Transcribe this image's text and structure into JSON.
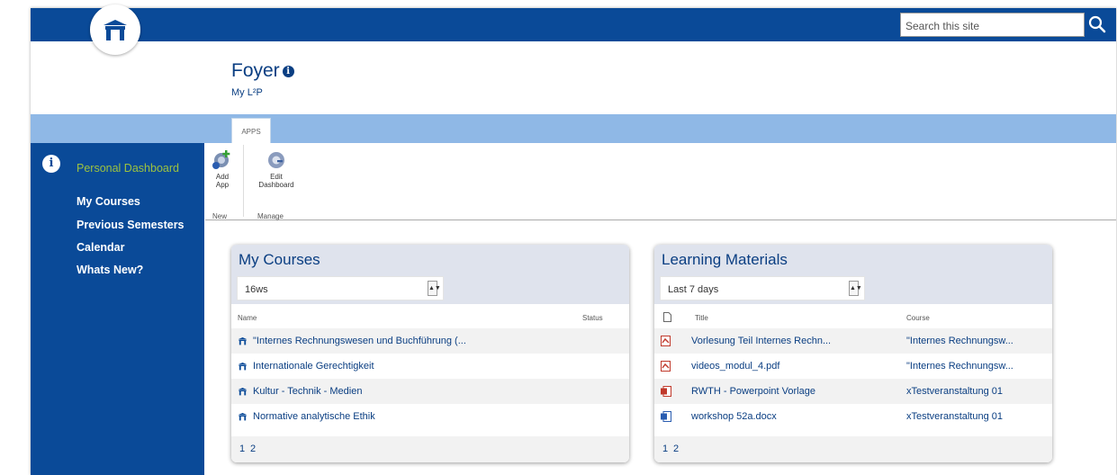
{
  "search": {
    "placeholder": "Search this site"
  },
  "site": {
    "title": "Foyer",
    "subtitle": "My L²P"
  },
  "ribbon": {
    "tab": "APPS",
    "buttons": [
      {
        "line1": "Add",
        "line2": "App"
      },
      {
        "line1": "Edit",
        "line2": "Dashboard"
      }
    ],
    "groups": [
      "New",
      "Manage"
    ]
  },
  "nav": {
    "items": [
      "Personal Dashboard",
      "My Courses",
      "Previous Semesters",
      "Calendar",
      "Whats New?"
    ]
  },
  "my_courses": {
    "title": "My Courses",
    "filter": "16ws",
    "columns": [
      "Name",
      "Status"
    ],
    "rows": [
      "\"Internes Rechnungswesen und Buchführung (...",
      "Internationale Gerechtigkeit",
      "Kultur - Technik - Medien",
      "Normative analytische Ethik"
    ],
    "pages": [
      "1",
      "2"
    ]
  },
  "learning_materials": {
    "title": "Learning Materials",
    "filter": "Last 7 days",
    "columns": [
      "Title",
      "Course"
    ],
    "rows": [
      {
        "title": "Vorlesung Teil Internes Rechn...",
        "course": "\"Internes Rechnungsw...",
        "icon": "pdf-icon"
      },
      {
        "title": "videos_modul_4.pdf",
        "course": "\"Internes Rechnungsw...",
        "icon": "pdf-icon"
      },
      {
        "title": "RWTH - Powerpoint Vorlage",
        "course": "xTestveranstaltung 01",
        "icon": "powerpoint-icon"
      },
      {
        "title": "workshop 52a.docx",
        "course": "xTestveranstaltung 01",
        "icon": "word-icon"
      }
    ],
    "pages": [
      "1",
      "2"
    ]
  },
  "colors": {
    "brand": "#0a4a98",
    "accent": "#9cc240",
    "ribbon": "#8fb8e6"
  }
}
